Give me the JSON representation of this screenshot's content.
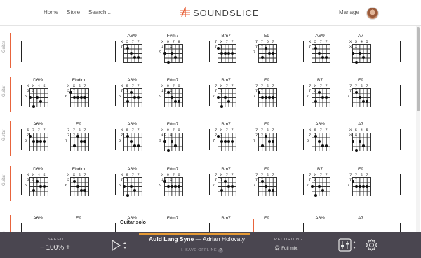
{
  "nav": {
    "home": "Home",
    "store": "Store",
    "search": "Search...",
    "brand": "SOUNDSLICE",
    "manage": "Manage"
  },
  "rows": [
    {
      "label": "Guitar",
      "chords": [
        {
          "name": "A6/9",
          "strings": "X 5 7 7 7 7",
          "fret": ""
        },
        {
          "name": "F#m7",
          "strings": "X 9 7 9 10 X",
          "fret": "9"
        },
        {
          "name": "Bm7",
          "strings": "7 X 7 7 7 7",
          "fret": ""
        },
        {
          "name": "E9",
          "strings": "7 7 6 7 7 7",
          "fret": "7"
        },
        {
          "name": "A6/9",
          "strings": "X 5 7 7 7 7",
          "fret": ""
        },
        {
          "name": "A7",
          "strings": "X 5 4 5 X X",
          "fret": ""
        }
      ]
    },
    {
      "label": "Guitar",
      "chords": [
        {
          "name": "D6/9",
          "strings": "X X 4 5 5 5",
          "fret": "5"
        },
        {
          "name": "Ebdim",
          "strings": "X X 6 7 5 7",
          "fret": "6"
        },
        {
          "name": "A6/9",
          "strings": "X 5 7 7 7 7",
          "fret": "5"
        },
        {
          "name": "F#m7",
          "strings": "X 9 7 9 10 X",
          "fret": "9"
        },
        {
          "name": "Bm7",
          "strings": "7 X 7 7 7 7",
          "fret": "7"
        },
        {
          "name": "E9",
          "strings": "7 7 6 7 7 7",
          "fret": "7"
        },
        {
          "name": "B7",
          "strings": "7 X 7 7 7 X",
          "fret": "7"
        },
        {
          "name": "E9",
          "strings": "7 7 6 7 7 7",
          "fret": "7"
        }
      ]
    },
    {
      "label": "Guitar",
      "chords": [
        {
          "name": "A6/9",
          "strings": "5 7 7 7 7",
          "fret": "5"
        },
        {
          "name": "E9",
          "strings": "7 7 6 7 7 7",
          "fret": "7"
        },
        {
          "name": "A6/9",
          "strings": "X 5 7 7 7 7",
          "fret": "5"
        },
        {
          "name": "F#m7",
          "strings": "X 9 7 9 10 X",
          "fret": "9"
        },
        {
          "name": "Bm7",
          "strings": "7 X 7 7 7 7",
          "fret": "7"
        },
        {
          "name": "E9",
          "strings": "7 7 6 7 7 7",
          "fret": "7"
        },
        {
          "name": "A6/9",
          "strings": "X 5 7 7 7 7",
          "fret": "5"
        },
        {
          "name": "A7",
          "strings": "X 5 4 5 X X",
          "fret": ""
        }
      ]
    },
    {
      "label": "Guitar",
      "chords": [
        {
          "name": "D6/9",
          "strings": "X X 4 5 5 5",
          "fret": "5"
        },
        {
          "name": "Ebdim",
          "strings": "X X 6 7 5 7",
          "fret": "6"
        },
        {
          "name": "A6/9",
          "strings": "X 5 7 7 7 7",
          "fret": "5"
        },
        {
          "name": "F#m7",
          "strings": "X 9 7 9 10 X",
          "fret": "9"
        },
        {
          "name": "Bm7",
          "strings": "7 X 7 7 7 7",
          "fret": "7"
        },
        {
          "name": "E9",
          "strings": "7 7 6 7 7 7",
          "fret": "7"
        },
        {
          "name": "B7",
          "strings": "7 X 7 7 7 X",
          "fret": "7"
        },
        {
          "name": "E9",
          "strings": "7 7 6 7 7 7",
          "fret": "7"
        }
      ]
    },
    {
      "label": "G",
      "chords": [
        {
          "name": "A6/9",
          "strings": "",
          "fret": ""
        },
        {
          "name": "E9",
          "strings": "",
          "fret": ""
        },
        {
          "name": "A6/9",
          "strings": "",
          "fret": ""
        },
        {
          "name": "F#m7",
          "strings": "",
          "fret": ""
        },
        {
          "name": "Bm7",
          "strings": "",
          "fret": ""
        },
        {
          "name": "E9",
          "strings": "",
          "fret": ""
        },
        {
          "name": "A6/9",
          "strings": "",
          "fret": ""
        },
        {
          "name": "A7",
          "strings": "",
          "fret": ""
        }
      ]
    }
  ],
  "section_label": "Guitar solo",
  "player": {
    "speed_label": "SPEED",
    "speed_value": "− 100% +",
    "song_title": "Auld Lang Syne",
    "song_artist": "— Adrian Holovaty",
    "save_offline": "SAVE OFFLINE",
    "recording_label": "RECORDING",
    "recording_value": "Full mix"
  }
}
